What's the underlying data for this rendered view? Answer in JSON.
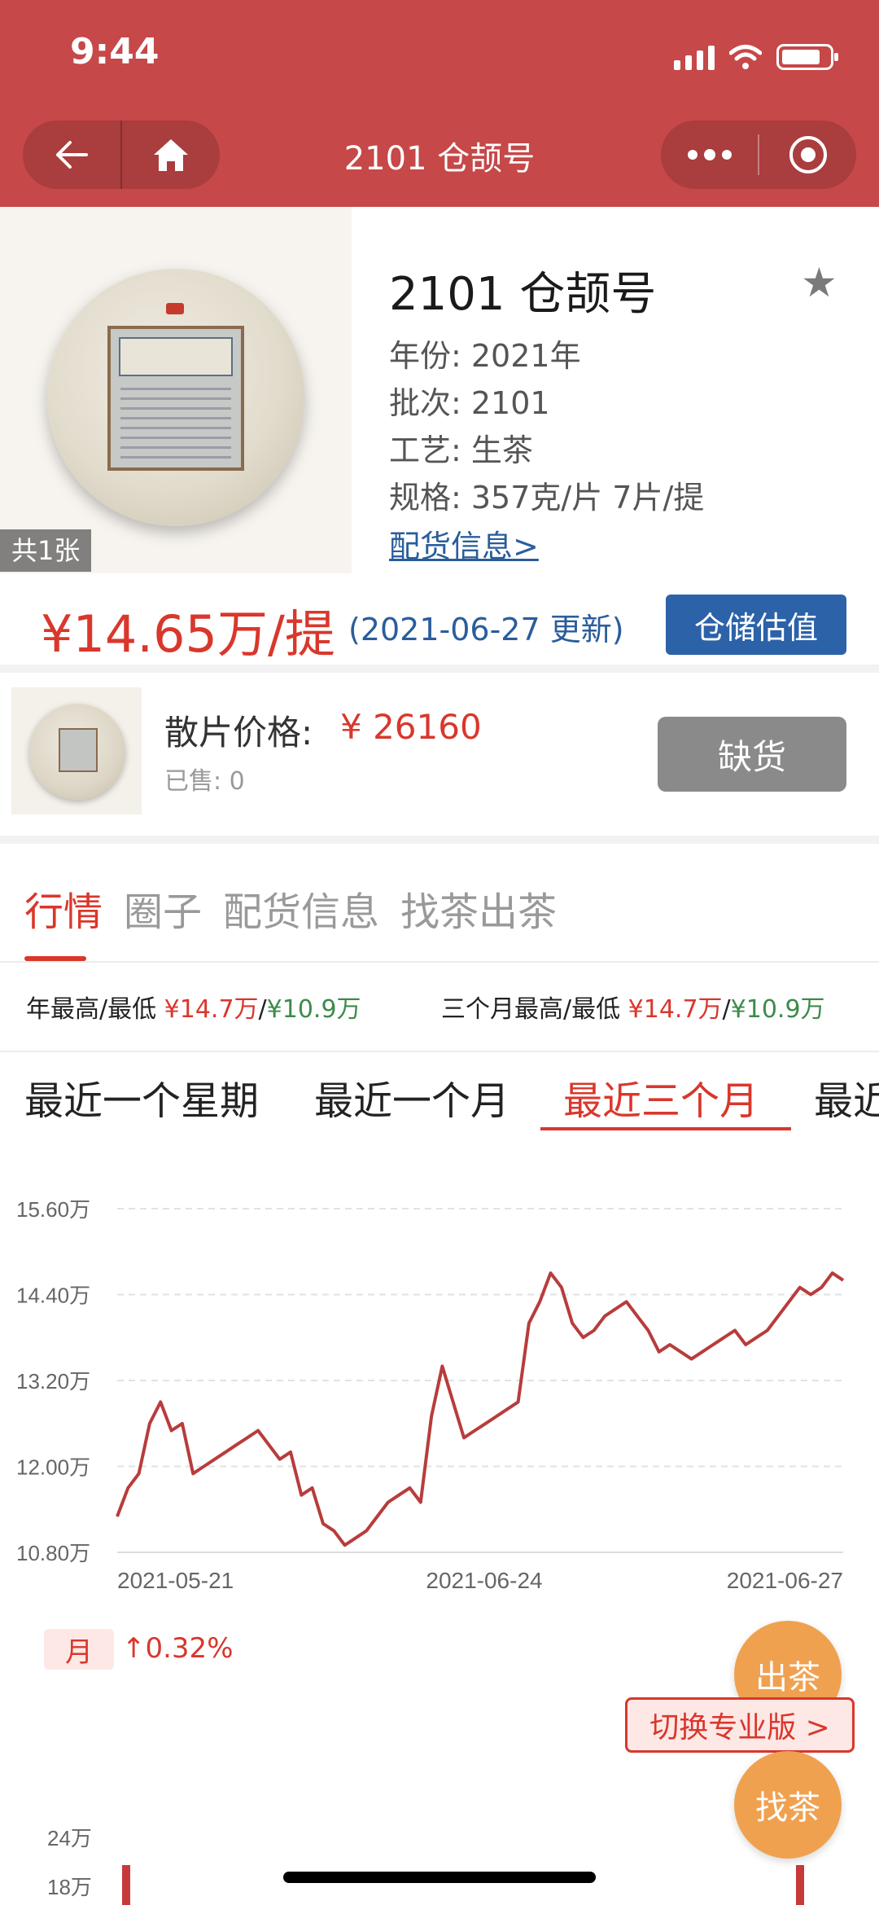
{
  "status_bar": {
    "time": "9:44"
  },
  "nav": {
    "title": "2101 仓颉号"
  },
  "product": {
    "photo_count": "共1张",
    "name": "2101 仓颉号",
    "year": "年份: 2021年",
    "batch": "批次: 2101",
    "process": "工艺: 生茶",
    "spec": "规格: 357克/片 7片/提",
    "delivery_link": "配货信息>",
    "price": "¥14.65万/提",
    "price_date": "(2021-06-27 更新)",
    "estimate_button": "仓储估值"
  },
  "loose": {
    "label": "散片价格:",
    "price": "¥ 26160",
    "sold": "已售: 0",
    "stock_button": "缺货"
  },
  "tabs": [
    {
      "label": "行情"
    },
    {
      "label": "圈子"
    },
    {
      "label": "配货信息"
    },
    {
      "label": "找茶出茶"
    }
  ],
  "stats": {
    "year_label": "年最高/最低",
    "year_high": "¥14.7万",
    "year_low": "¥10.9万",
    "three_month_label": "三个月最高/最低",
    "three_month_high": "¥14.7万",
    "three_month_low": "¥10.9万",
    "slash": "/"
  },
  "periods": [
    {
      "label": "最近一个星期"
    },
    {
      "label": "最近一个月"
    },
    {
      "label": "最近三个月"
    },
    {
      "label": "最近"
    }
  ],
  "chart_data": {
    "type": "line",
    "x_tick_labels": [
      "2021-05-21",
      "2021-06-24",
      "2021-06-27"
    ],
    "y_tick_labels": [
      "15.60万",
      "14.40万",
      "13.20万",
      "12.00万",
      "10.80万"
    ],
    "ylim": [
      10.8,
      15.6
    ],
    "series": [
      {
        "values": [
          11.3,
          11.7,
          11.9,
          12.6,
          12.9,
          12.5,
          12.6,
          11.9,
          12.0,
          12.1,
          12.2,
          12.3,
          12.4,
          12.5,
          12.3,
          12.1,
          12.2,
          11.6,
          11.7,
          11.2,
          11.1,
          10.9,
          11.0,
          11.1,
          11.3,
          11.5,
          11.6,
          11.7,
          11.5,
          12.7,
          13.4,
          12.9,
          12.4,
          12.5,
          12.6,
          12.7,
          12.8,
          12.9,
          14.0,
          14.3,
          14.7,
          14.5,
          14.0,
          13.8,
          13.9,
          14.1,
          14.2,
          14.3,
          14.1,
          13.9,
          13.6,
          13.7,
          13.6,
          13.5,
          13.6,
          13.7,
          13.8,
          13.9,
          13.7,
          13.8,
          13.9,
          14.1,
          14.3,
          14.5,
          14.4,
          14.5,
          14.7,
          14.6
        ]
      }
    ],
    "grid": true,
    "line_color": "#b83c3c"
  },
  "month_change": {
    "badge": "月",
    "value": "↑0.32%"
  },
  "actions": {
    "sell": "出茶",
    "find": "找茶",
    "switch": "切换专业版 >"
  },
  "volume_chart": {
    "y_tick_labels": [
      "24万",
      "18万"
    ]
  }
}
